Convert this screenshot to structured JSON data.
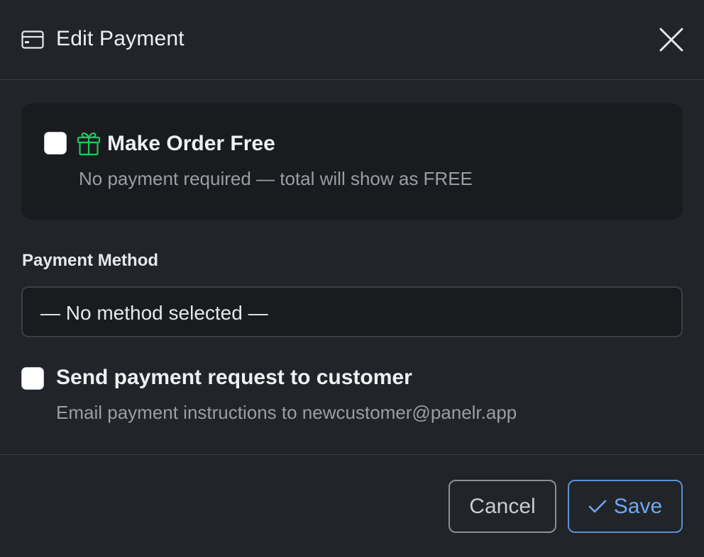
{
  "header": {
    "title": "Edit Payment",
    "card_icon": "credit-card-icon",
    "close_icon": "close-icon"
  },
  "free_option": {
    "checked": false,
    "icon": "gift-icon",
    "icon_color": "#22c55e",
    "label": "Make Order Free",
    "hint": "No payment required — total will show as FREE"
  },
  "payment_method": {
    "label": "Payment Method",
    "selected": "— No method selected —"
  },
  "send_request": {
    "checked": false,
    "label": "Send payment request to customer",
    "hint": "Email payment instructions to newcustomer@panelr.app"
  },
  "footer": {
    "cancel_label": "Cancel",
    "save_label": "Save",
    "save_icon": "checkmark-icon",
    "accent_color": "#6ea8f0"
  }
}
